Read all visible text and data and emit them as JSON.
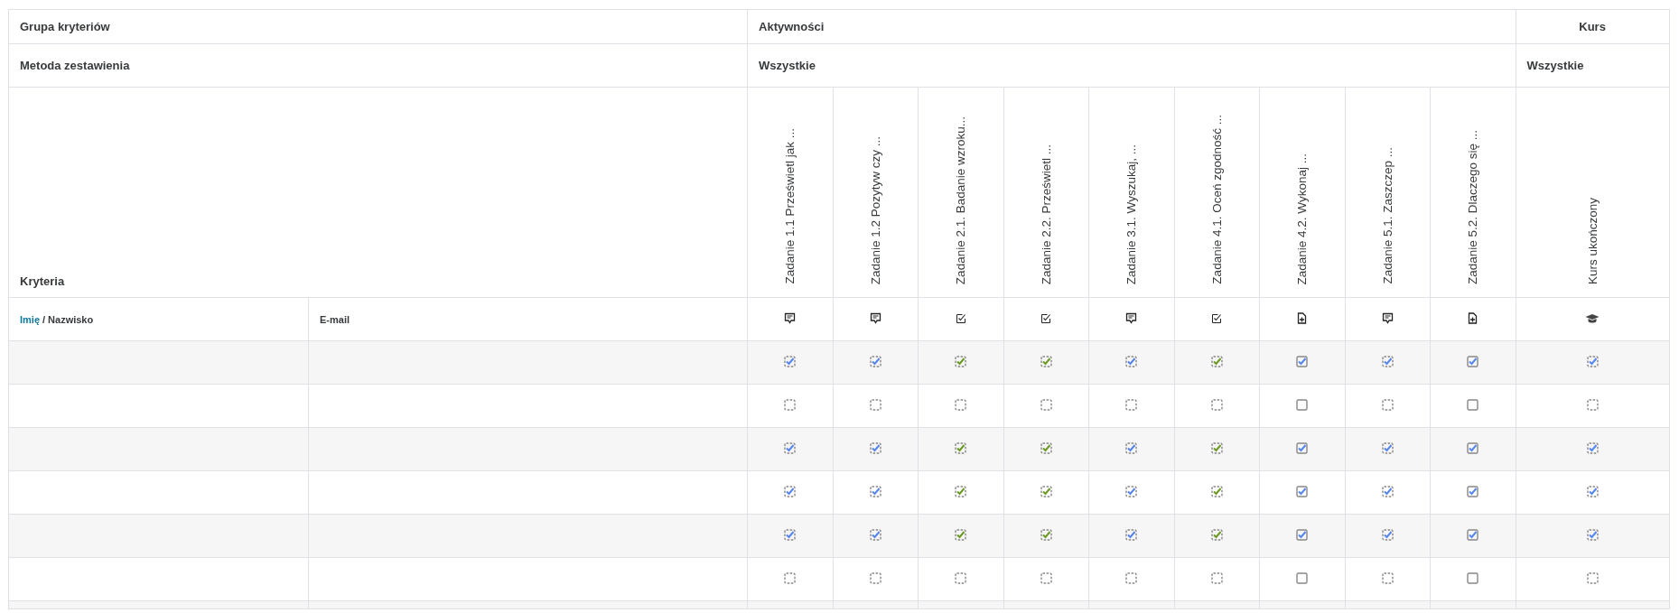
{
  "header": {
    "criteria_group_label": "Grupa kryteriów",
    "activities_group": "Aktywności",
    "course_group": "Kurs",
    "method_label": "Metoda zestawienia",
    "activities_method": "Wszystkie",
    "course_method": "Wszystkie",
    "criteria_label": "Kryteria"
  },
  "name_sort": [
    {
      "label": "Imię",
      "selected": true
    },
    {
      "label": "Nazwisko",
      "selected": false
    }
  ],
  "name_separator": "/",
  "email_label": "E-mail",
  "columns": [
    {
      "label": "Zadanie 1.1 Prześwietl jak ...",
      "kind": "forum",
      "manual": false
    },
    {
      "label": "Zadanie 1.2 Pozytyw czy ...",
      "kind": "forum",
      "manual": false
    },
    {
      "label": "Zadanie 2.1. Badanie wzroku...",
      "kind": "quiz",
      "manual": false
    },
    {
      "label": "Zadanie 2.2. Prześwietl ...",
      "kind": "quiz",
      "manual": false
    },
    {
      "label": "Zadanie 3.1. Wyszukaj, ...",
      "kind": "forum",
      "manual": false
    },
    {
      "label": "Zadanie 4.1. Oceń zgodność ...",
      "kind": "quiz",
      "manual": false
    },
    {
      "label": "Zadanie 4.2. Wykonaj ...",
      "kind": "assignment",
      "manual": true
    },
    {
      "label": "Zadanie 5.1. Zaszczep ...",
      "kind": "forum",
      "manual": false
    },
    {
      "label": "Zadanie 5.2. Dlaczego się ...",
      "kind": "assignment",
      "manual": true
    },
    {
      "label": "Kurs ukończony",
      "kind": "course",
      "manual": false
    }
  ],
  "rows": [
    {
      "cells": [
        {
          "checked": true,
          "passed": false
        },
        {
          "checked": true,
          "passed": false
        },
        {
          "checked": true,
          "passed": true
        },
        {
          "checked": true,
          "passed": true
        },
        {
          "checked": true,
          "passed": false
        },
        {
          "checked": true,
          "passed": true
        },
        {
          "checked": true,
          "passed": false
        },
        {
          "checked": true,
          "passed": false
        },
        {
          "checked": true,
          "passed": false
        },
        {
          "checked": true,
          "passed": false
        }
      ]
    },
    {
      "cells": [
        {
          "checked": false
        },
        {
          "checked": false
        },
        {
          "checked": false
        },
        {
          "checked": false
        },
        {
          "checked": false
        },
        {
          "checked": false
        },
        {
          "checked": false
        },
        {
          "checked": false
        },
        {
          "checked": false
        },
        {
          "checked": false
        }
      ]
    },
    {
      "cells": [
        {
          "checked": true,
          "passed": false
        },
        {
          "checked": true,
          "passed": false
        },
        {
          "checked": true,
          "passed": true
        },
        {
          "checked": true,
          "passed": true
        },
        {
          "checked": true,
          "passed": false
        },
        {
          "checked": true,
          "passed": true
        },
        {
          "checked": true,
          "passed": false
        },
        {
          "checked": true,
          "passed": false
        },
        {
          "checked": true,
          "passed": false
        },
        {
          "checked": true,
          "passed": false
        }
      ]
    },
    {
      "cells": [
        {
          "checked": true,
          "passed": false
        },
        {
          "checked": true,
          "passed": false
        },
        {
          "checked": true,
          "passed": true
        },
        {
          "checked": true,
          "passed": true
        },
        {
          "checked": true,
          "passed": false
        },
        {
          "checked": true,
          "passed": true
        },
        {
          "checked": true,
          "passed": false
        },
        {
          "checked": true,
          "passed": false
        },
        {
          "checked": true,
          "passed": false
        },
        {
          "checked": true,
          "passed": false
        }
      ]
    },
    {
      "cells": [
        {
          "checked": true,
          "passed": false
        },
        {
          "checked": true,
          "passed": false
        },
        {
          "checked": true,
          "passed": true
        },
        {
          "checked": true,
          "passed": true
        },
        {
          "checked": true,
          "passed": false
        },
        {
          "checked": true,
          "passed": true
        },
        {
          "checked": true,
          "passed": false
        },
        {
          "checked": true,
          "passed": false
        },
        {
          "checked": true,
          "passed": false
        },
        {
          "checked": true,
          "passed": false
        }
      ]
    },
    {
      "cells": [
        {
          "checked": false
        },
        {
          "checked": false
        },
        {
          "checked": false
        },
        {
          "checked": false
        },
        {
          "checked": false
        },
        {
          "checked": false
        },
        {
          "checked": false
        },
        {
          "checked": false
        },
        {
          "checked": false
        },
        {
          "checked": false
        }
      ]
    }
  ]
}
